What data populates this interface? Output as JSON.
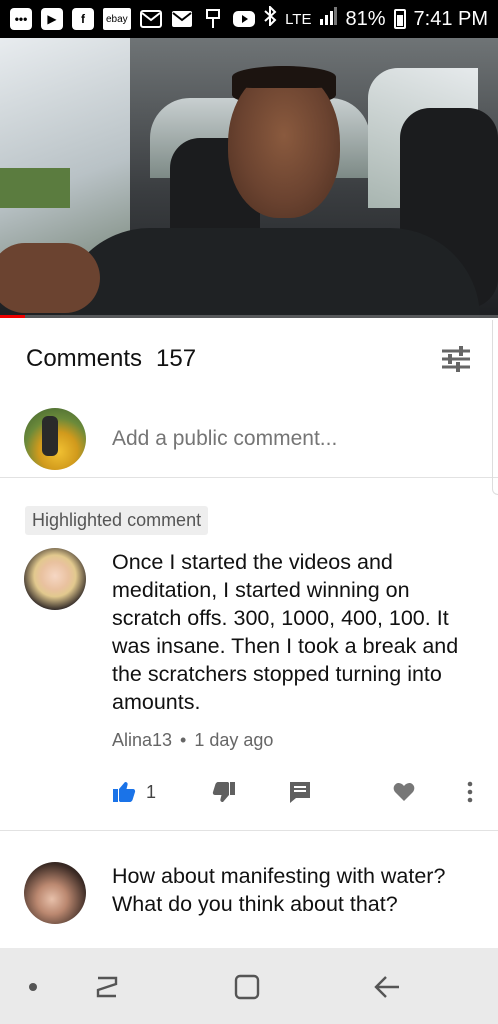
{
  "status_bar": {
    "notification_icons": [
      "more-dots-icon",
      "youtube-icon",
      "facebook-icon",
      "ebay-icon",
      "gmail-icon",
      "email-icon",
      "fiverr-icon",
      "youtube-icon"
    ],
    "ebay_label": "ebay",
    "bluetooth": "bluetooth-icon",
    "network": "LTE",
    "battery": "81%",
    "time": "7:41 PM"
  },
  "video": {
    "progress_fraction": 0.05,
    "accent_color": "#ee0000"
  },
  "comments": {
    "title": "Comments",
    "count": "157",
    "sort_icon": "sort-sliders-icon",
    "add_placeholder": "Add a public comment..."
  },
  "highlighted": {
    "badge": "Highlighted comment"
  },
  "comment_list": [
    {
      "text": "Once I started the videos and meditation, I started winning on scratch offs. 300, 1000, 400, 100. It was insane. Then I took a break and the scratchers stopped turning into amounts.",
      "author": "Alina13",
      "separator": "•",
      "time": "1 day ago",
      "likes": "1",
      "like_color": "#1a73e8"
    },
    {
      "text": "How about manifesting with water? What do you think about that?"
    }
  ],
  "nav": {
    "items": [
      "dot-icon",
      "recent-apps-icon",
      "home-icon",
      "back-icon"
    ]
  }
}
